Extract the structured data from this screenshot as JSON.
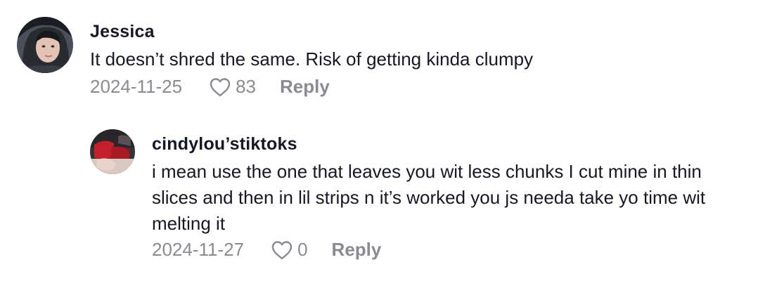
{
  "comments": [
    {
      "username": "Jessica",
      "text": "It doesn’t shred the same. Risk of getting kinda clumpy",
      "date": "2024-11-25",
      "likes": "83",
      "reply_label": "Reply"
    }
  ],
  "replies": [
    {
      "username": "cindylou’stiktoks",
      "text": "i mean use the one that leaves you wit less chunks I cut mine in thin slices and then in lil strips n it’s worked you js needa take yo time wit melting it",
      "date": "2024-11-27",
      "likes": "0",
      "reply_label": "Reply"
    }
  ],
  "icons": {
    "like": "heart-outline-icon"
  },
  "colors": {
    "text_primary": "#161823",
    "text_secondary": "#8a8b91"
  }
}
